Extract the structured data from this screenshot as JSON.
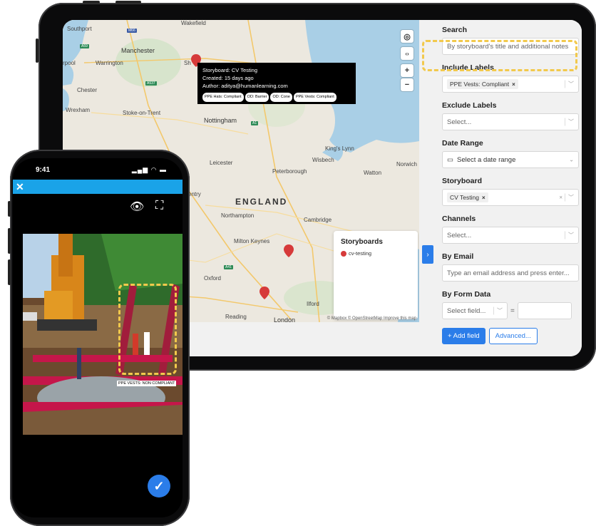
{
  "map": {
    "places": [
      {
        "name": "Southport"
      },
      {
        "name": "Wakefield"
      },
      {
        "name": "Manchester"
      },
      {
        "name": "Warrington"
      },
      {
        "name": "rpool"
      },
      {
        "name": "Chester"
      },
      {
        "name": "Wrexham"
      },
      {
        "name": "Stoke-on-Trent"
      },
      {
        "name": "Sh"
      },
      {
        "name": "Nottingham"
      },
      {
        "name": "King's Lynn"
      },
      {
        "name": "Wisbech"
      },
      {
        "name": "Norwich"
      },
      {
        "name": "Leicester"
      },
      {
        "name": "Peterborough"
      },
      {
        "name": "Watton"
      },
      {
        "name": "entry"
      },
      {
        "name": "ENGLAND"
      },
      {
        "name": "Northampton"
      },
      {
        "name": "Cambridge"
      },
      {
        "name": "Milton Keynes"
      },
      {
        "name": "Oxford"
      },
      {
        "name": "Reading"
      },
      {
        "name": "London"
      },
      {
        "name": "Ilford"
      }
    ],
    "road_badges": [
      "M66",
      "A59",
      "A537",
      "A1",
      "A41"
    ],
    "controls": {
      "locate": "◎",
      "toggle": "‹›",
      "zoom_in": "+",
      "zoom_out": "−"
    },
    "tooltip": {
      "title": "Storyboard: CV Testing",
      "created": "Created: 15 days ago",
      "author": "Author: aditya@humanlearning.com",
      "chips": [
        "PPE Hats: Compliant",
        "OD: Barrier",
        "OD: Cone",
        "PPE Vests: Compliant"
      ]
    },
    "legend": {
      "title": "Storyboards",
      "items": [
        {
          "label": "cv-testing",
          "color": "#d63a3a"
        }
      ]
    },
    "attribution": "© Mapbox © OpenStreetMap Improve this map",
    "expand": "›"
  },
  "filters": {
    "search": {
      "label": "Search",
      "placeholder": "By storyboard's title and additional notes"
    },
    "include_labels": {
      "label": "Include Labels",
      "tags": [
        "PPE Vests: Compliant"
      ]
    },
    "exclude_labels": {
      "label": "Exclude Labels",
      "placeholder": "Select..."
    },
    "date_range": {
      "label": "Date Range",
      "placeholder": "Select a date range"
    },
    "storyboard": {
      "label": "Storyboard",
      "tags": [
        "CV Testing"
      ]
    },
    "channels": {
      "label": "Channels",
      "placeholder": "Select..."
    },
    "by_email": {
      "label": "By Email",
      "placeholder": "Type an email address and press enter..."
    },
    "by_form_data": {
      "label": "By Form Data",
      "field_placeholder": "Select field...",
      "operator": "="
    },
    "add_field": "+ Add field",
    "advanced": "Advanced..."
  },
  "phone": {
    "time": "9:41",
    "status_icons": "▂▄▆ ◠ ▬",
    "close": "✕",
    "eye_icon": "👁",
    "crop_icon": "⛶",
    "detection_label": "PPE VESTS: NON COMPLIANT",
    "confirm": "✓"
  },
  "colors": {
    "accent": "#2b7de9",
    "appbar": "#1aa3e8",
    "pin": "#d63a3a",
    "highlight": "#f2c94c"
  }
}
